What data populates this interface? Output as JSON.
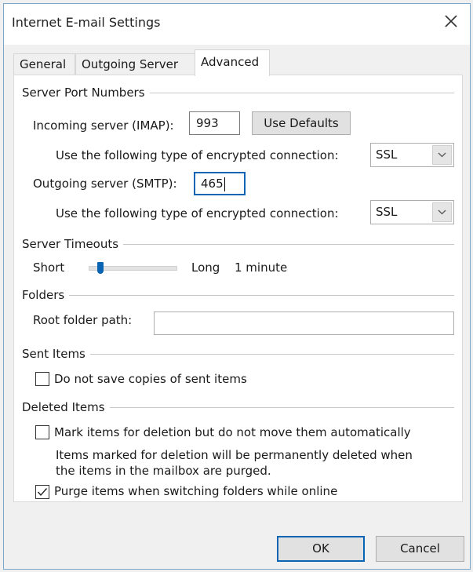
{
  "window": {
    "title": "Internet E-mail Settings",
    "close_icon": "close-icon"
  },
  "tabs": [
    {
      "label": "General",
      "active": false
    },
    {
      "label": "Outgoing Server",
      "active": false
    },
    {
      "label": "Advanced",
      "active": true
    }
  ],
  "server_ports": {
    "group_label": "Server Port Numbers",
    "incoming_label": "Incoming server (IMAP):",
    "incoming_value": "993",
    "use_defaults_label": "Use Defaults",
    "incoming_encryption_label": "Use the following type of encrypted connection:",
    "incoming_encryption_value": "SSL",
    "outgoing_label": "Outgoing server (SMTP):",
    "outgoing_value": "465",
    "outgoing_encryption_label": "Use the following type of encrypted connection:",
    "outgoing_encryption_value": "SSL"
  },
  "timeouts": {
    "group_label": "Server Timeouts",
    "short_label": "Short",
    "long_label": "Long",
    "value_label": "1 minute",
    "slider_fraction": 0.1
  },
  "folders": {
    "group_label": "Folders",
    "root_label": "Root folder path:",
    "root_value": ""
  },
  "sent_items": {
    "group_label": "Sent Items",
    "no_copies_label": "Do not save copies of sent items",
    "no_copies_checked": false
  },
  "deleted_items": {
    "group_label": "Deleted Items",
    "mark_label": "Mark items for deletion but do not move them automatically",
    "mark_checked": false,
    "note_line1": "Items marked for deletion will be permanently deleted when",
    "note_line2": "the items in the mailbox are purged.",
    "purge_label": "Purge items when switching folders while online",
    "purge_checked": true
  },
  "footer": {
    "ok_label": "OK",
    "cancel_label": "Cancel"
  },
  "colors": {
    "accent": "#0a64b4",
    "border": "#7aa6cc"
  }
}
